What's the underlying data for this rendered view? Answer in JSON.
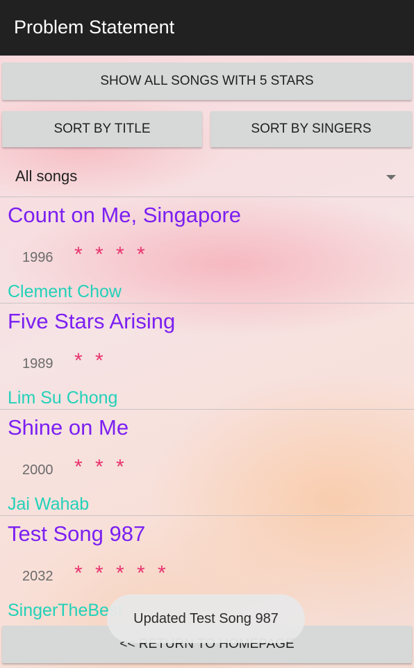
{
  "app_bar": {
    "title": "Problem Statement"
  },
  "buttons": {
    "show_five_stars": "SHOW ALL SONGS WITH 5 STARS",
    "sort_by_title": "SORT BY TITLE",
    "sort_by_singers": "SORT BY SINGERS",
    "return_home": "<< RETURN TO HOMEPAGE"
  },
  "filter": {
    "selected": "All songs"
  },
  "songs": [
    {
      "title": "Count on Me, Singapore",
      "year": "1996",
      "stars": "* * * *",
      "rating": 4,
      "singer": "Clement Chow"
    },
    {
      "title": "Five Stars Arising",
      "year": "1989",
      "stars": "* *",
      "rating": 2,
      "singer": "Lim Su Chong"
    },
    {
      "title": "Shine on Me",
      "year": "2000",
      "stars": "* * *",
      "rating": 3,
      "singer": "Jai Wahab"
    },
    {
      "title": "Test Song 987",
      "year": "2032",
      "stars": "* * * * *",
      "rating": 5,
      "singer": "SingerTheBest"
    }
  ],
  "toast": {
    "message": "Updated Test Song 987"
  },
  "colors": {
    "app_bar": "#212121",
    "button": "#d7d8d8",
    "title_text": "#7b1ff2",
    "singer_text": "#22d1b9",
    "star_text": "#e8336f"
  }
}
